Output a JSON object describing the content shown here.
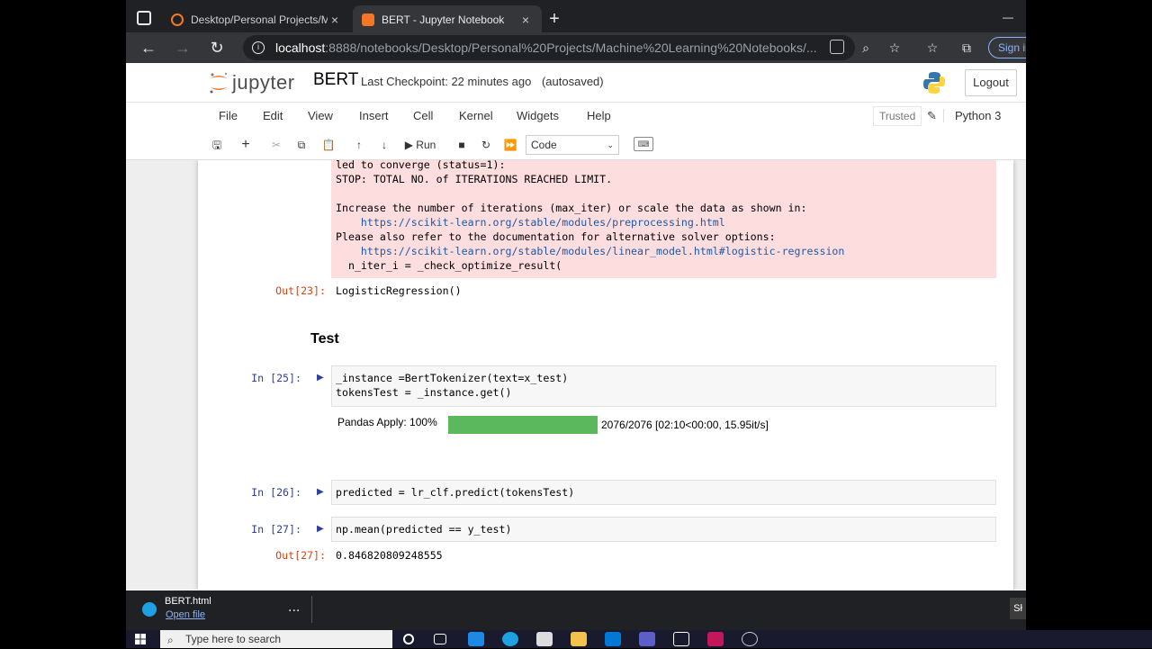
{
  "browser": {
    "tabs": [
      {
        "title": "Desktop/Personal Projects/Machi",
        "close": "×"
      },
      {
        "title": "BERT - Jupyter Notebook",
        "close": "×"
      }
    ],
    "new_tab": "+",
    "url_host": "localhost",
    "url_path": ":8888/notebooks/Desktop/Personal%20Projects/Machine%20Learning%20Notebooks/...",
    "sign_in": "Sign in",
    "colors": {
      "tabstrip": "#202124",
      "toolbar": "#35363a",
      "accent": "#8ab4f8"
    }
  },
  "jupyter": {
    "logo_text": "jupyter",
    "notebook_name": "BERT",
    "checkpoint": "Last Checkpoint: 22 minutes ago",
    "autosave": "(autosaved)",
    "logout": "Logout",
    "menus": [
      "File",
      "Edit",
      "View",
      "Insert",
      "Cell",
      "Kernel",
      "Widgets",
      "Help"
    ],
    "trusted": "Trusted",
    "kernel": "Python 3",
    "run_label": "Run",
    "cell_type": "Code"
  },
  "cells": {
    "stderr_lines": [
      "led to converge (status=1):",
      "STOP: TOTAL NO. of ITERATIONS REACHED LIMIT.",
      "",
      "Increase the number of iterations (max_iter) or scale the data as shown in:",
      "    https://scikit-learn.org/stable/modules/preprocessing.html",
      "Please also refer to the documentation for alternative solver options:",
      "    https://scikit-learn.org/stable/modules/linear_model.html#logistic-regression",
      "  n_iter_i = _check_optimize_result("
    ],
    "out23_prompt": "Out[23]:",
    "out23_text": "LogisticRegression()",
    "heading": "Test",
    "in25_prompt": "In [25]:",
    "in25_line1": "_instance =BertTokenizer(text=x_test)",
    "in25_line2": "tokensTest = _instance.get()",
    "progress_label": "Pandas Apply: 100%",
    "progress_fraction": 1.0,
    "progress_stats": "2076/2076 [02:10<00:00, 15.95it/s]",
    "in26_prompt": "In [26]:",
    "in26_code": "predicted = lr_clf.predict(tokensTest)",
    "in27_prompt": "In [27]:",
    "in27_code": "np.mean(predicted == y_test)",
    "out27_prompt": "Out[27]:",
    "out27_text": "0.846820809248555"
  },
  "download": {
    "file": "BERT.html",
    "open": "Open file",
    "more": "..."
  },
  "taskbar": {
    "search_placeholder": "Type here to search",
    "peek": "Sł"
  }
}
